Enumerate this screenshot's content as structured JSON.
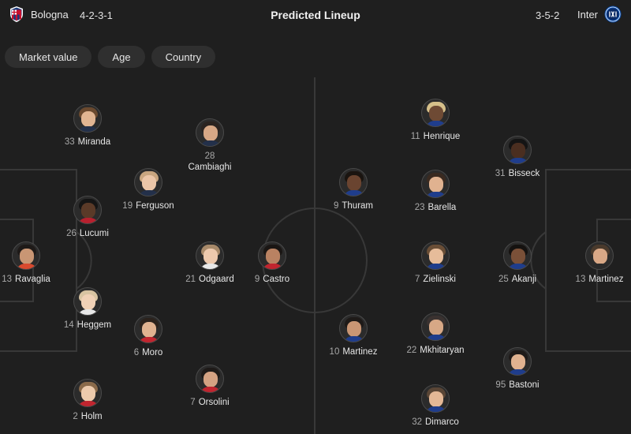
{
  "header": {
    "home_team": "Bologna",
    "home_formation": "4-2-3-1",
    "title": "Predicted Lineup",
    "away_formation": "3-5-2",
    "away_team": "Inter",
    "home_crest_icon": "bologna-crest-icon",
    "away_crest_icon": "inter-crest-icon"
  },
  "filters": [
    {
      "label": "Market value"
    },
    {
      "label": "Age"
    },
    {
      "label": "Country"
    }
  ],
  "colors": {
    "background": "#1f1f1f",
    "chip": "#2f2f2f",
    "pitch_lines": "#383838",
    "muted_text": "#a8a8a8"
  },
  "home_players": [
    {
      "number": "33",
      "name": "Miranda"
    },
    {
      "number": "28",
      "name": "Cambiaghi"
    },
    {
      "number": "19",
      "name": "Ferguson"
    },
    {
      "number": "26",
      "name": "Lucumi"
    },
    {
      "number": "13",
      "name": "Ravaglia"
    },
    {
      "number": "21",
      "name": "Odgaard"
    },
    {
      "number": "9",
      "name": "Castro"
    },
    {
      "number": "14",
      "name": "Heggem"
    },
    {
      "number": "6",
      "name": "Moro"
    },
    {
      "number": "7",
      "name": "Orsolini"
    },
    {
      "number": "2",
      "name": "Holm"
    }
  ],
  "away_players": [
    {
      "number": "11",
      "name": "Henrique"
    },
    {
      "number": "31",
      "name": "Bisseck"
    },
    {
      "number": "9",
      "name": "Thuram"
    },
    {
      "number": "23",
      "name": "Barella"
    },
    {
      "number": "7",
      "name": "Zielinski"
    },
    {
      "number": "25",
      "name": "Akanji"
    },
    {
      "number": "13",
      "name": "Martinez"
    },
    {
      "number": "10",
      "name": "Martinez"
    },
    {
      "number": "22",
      "name": "Mkhitaryan"
    },
    {
      "number": "95",
      "name": "Bastoni"
    },
    {
      "number": "32",
      "name": "Dimarco"
    }
  ]
}
